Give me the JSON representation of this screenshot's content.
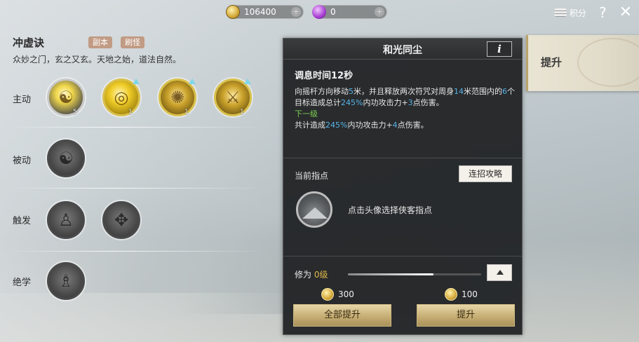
{
  "top_bar": {
    "coins": "106400",
    "gems": "0",
    "points_label": "积分",
    "help_label": "?",
    "close_label": "✕",
    "plus_label": "+"
  },
  "left": {
    "title": "冲虚诀",
    "tags": [
      "副本",
      "刷怪"
    ],
    "motto": "众妙之门，玄之又玄。天地之始，道法自然。",
    "rows": {
      "active": "主动",
      "passive": "被动",
      "trigger": "触发",
      "ultimate": "绝学"
    },
    "active_levels": [
      "5",
      "1",
      "1",
      "1"
    ]
  },
  "panel": {
    "title": "和光同尘",
    "info_label": "i",
    "cooldown": "调息时间12秒",
    "desc_parts": {
      "p1": "向摇杆方向移动",
      "v1": "5",
      "p2": "米，并且释放两次符咒对周身",
      "v2": "14",
      "p3": "米范围内的",
      "v3": "6",
      "p4": "个目标造成总计",
      "v4": "245%",
      "p5": "内功攻击力+",
      "v5": "3",
      "p6": "点伤害。",
      "next_label": "下一级",
      "n1": "共计造成",
      "nv1": "245%",
      "n2": "内功攻击力+",
      "nv2": "4",
      "n3": "点伤害。"
    },
    "guide_label": "当前指点",
    "combo_button": "连招攻略",
    "avatar_hint": "点击头像选择侠客指点",
    "cultivation_label": "修为",
    "cultivation_level": "0级",
    "cultivation_progress": 0.64,
    "cost_all": "300",
    "cost_one": "100",
    "upgrade_all_button": "全部提升",
    "upgrade_button": "提升"
  },
  "side_tab": {
    "label": "提升"
  }
}
